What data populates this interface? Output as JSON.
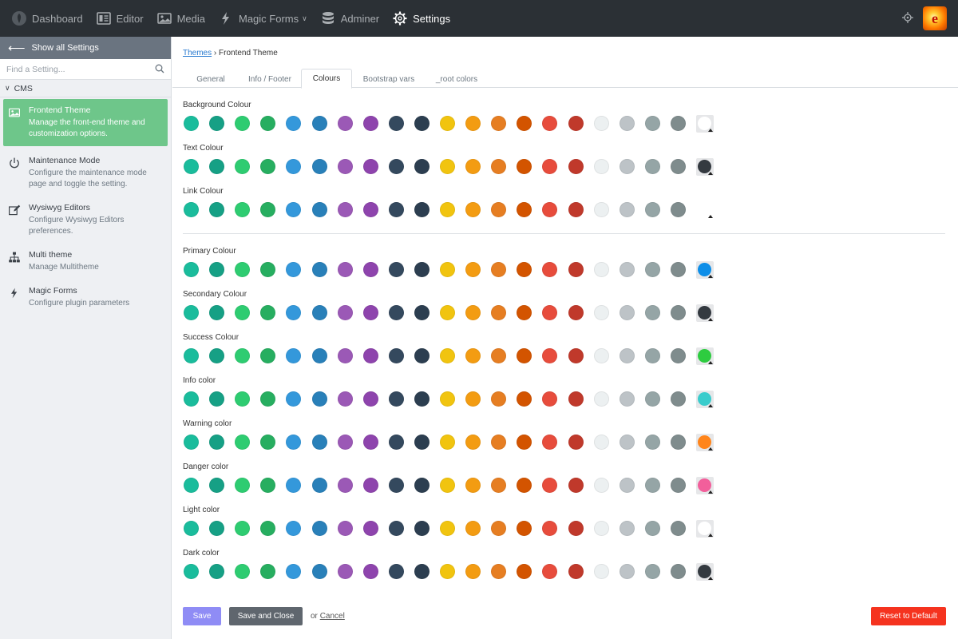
{
  "topbar": {
    "items": [
      {
        "label": "Dashboard",
        "icon": "leaf-logo-icon"
      },
      {
        "label": "Editor",
        "icon": "editor-icon"
      },
      {
        "label": "Media",
        "icon": "image-icon"
      },
      {
        "label": "Magic Forms",
        "icon": "bolt-icon",
        "dropdown": true
      },
      {
        "label": "Adminer",
        "icon": "database-icon"
      },
      {
        "label": "Settings",
        "icon": "gear-icon",
        "active": true
      }
    ],
    "right_icons": [
      "locate-icon",
      "user-avatar"
    ],
    "avatar_letter": "e"
  },
  "sidebar": {
    "back_label": "Show all Settings",
    "search_placeholder": "Find a Setting...",
    "section_label": "CMS",
    "items": [
      {
        "title": "Frontend Theme",
        "desc": "Manage the front-end theme and customization options.",
        "icon": "image-icon",
        "active": true
      },
      {
        "title": "Maintenance Mode",
        "desc": "Configure the maintenance mode page and toggle the setting.",
        "icon": "power-icon"
      },
      {
        "title": "Wysiwyg Editors",
        "desc": "Configure Wysiwyg Editors preferences.",
        "icon": "edit-icon"
      },
      {
        "title": "Multi theme",
        "desc": "Manage Multitheme",
        "icon": "sitemap-icon"
      },
      {
        "title": "Magic Forms",
        "desc": "Configure plugin parameters",
        "icon": "bolt-icon"
      }
    ]
  },
  "main": {
    "breadcrumb": {
      "link": "Themes",
      "separator": "›",
      "current": "Frontend Theme"
    },
    "tabs": [
      "General",
      "Info / Footer",
      "Colours",
      "Bootstrap vars",
      "_root colors"
    ],
    "active_tab": "Colours",
    "palette": [
      "#1abc9c",
      "#16a085",
      "#2ecc71",
      "#27ae60",
      "#3498db",
      "#2980b9",
      "#9b59b6",
      "#8e44ad",
      "#34495e",
      "#2c3e50",
      "#f1c40f",
      "#f39c12",
      "#e67e22",
      "#d35400",
      "#e74c3c",
      "#c0392b",
      "#ecf0f1",
      "#bdc3c7",
      "#95a5a6",
      "#7f8c8d"
    ],
    "color_groups": [
      {
        "label": "Background Colour",
        "selected": "#ffffff"
      },
      {
        "label": "Text Colour",
        "selected": "#343a40"
      },
      {
        "label": "Link Colour",
        "selected": "#ffffff",
        "bare": true
      },
      {
        "label": "Primary Colour",
        "selected": "#0d8ee8"
      },
      {
        "label": "Secondary Colour",
        "selected": "#343a40"
      },
      {
        "label": "Success Colour",
        "selected": "#2ecc40"
      },
      {
        "label": "Info color",
        "selected": "#39cccc"
      },
      {
        "label": "Warning color",
        "selected": "#ff851b"
      },
      {
        "label": "Danger color",
        "selected": "#f25f9b"
      },
      {
        "label": "Light color",
        "selected": "#ffffff"
      },
      {
        "label": "Dark color",
        "selected": "#343a40"
      }
    ],
    "buttons": {
      "save": "Save",
      "save_close": "Save and Close",
      "or": "or",
      "cancel": "Cancel",
      "reset": "Reset to Default"
    }
  }
}
